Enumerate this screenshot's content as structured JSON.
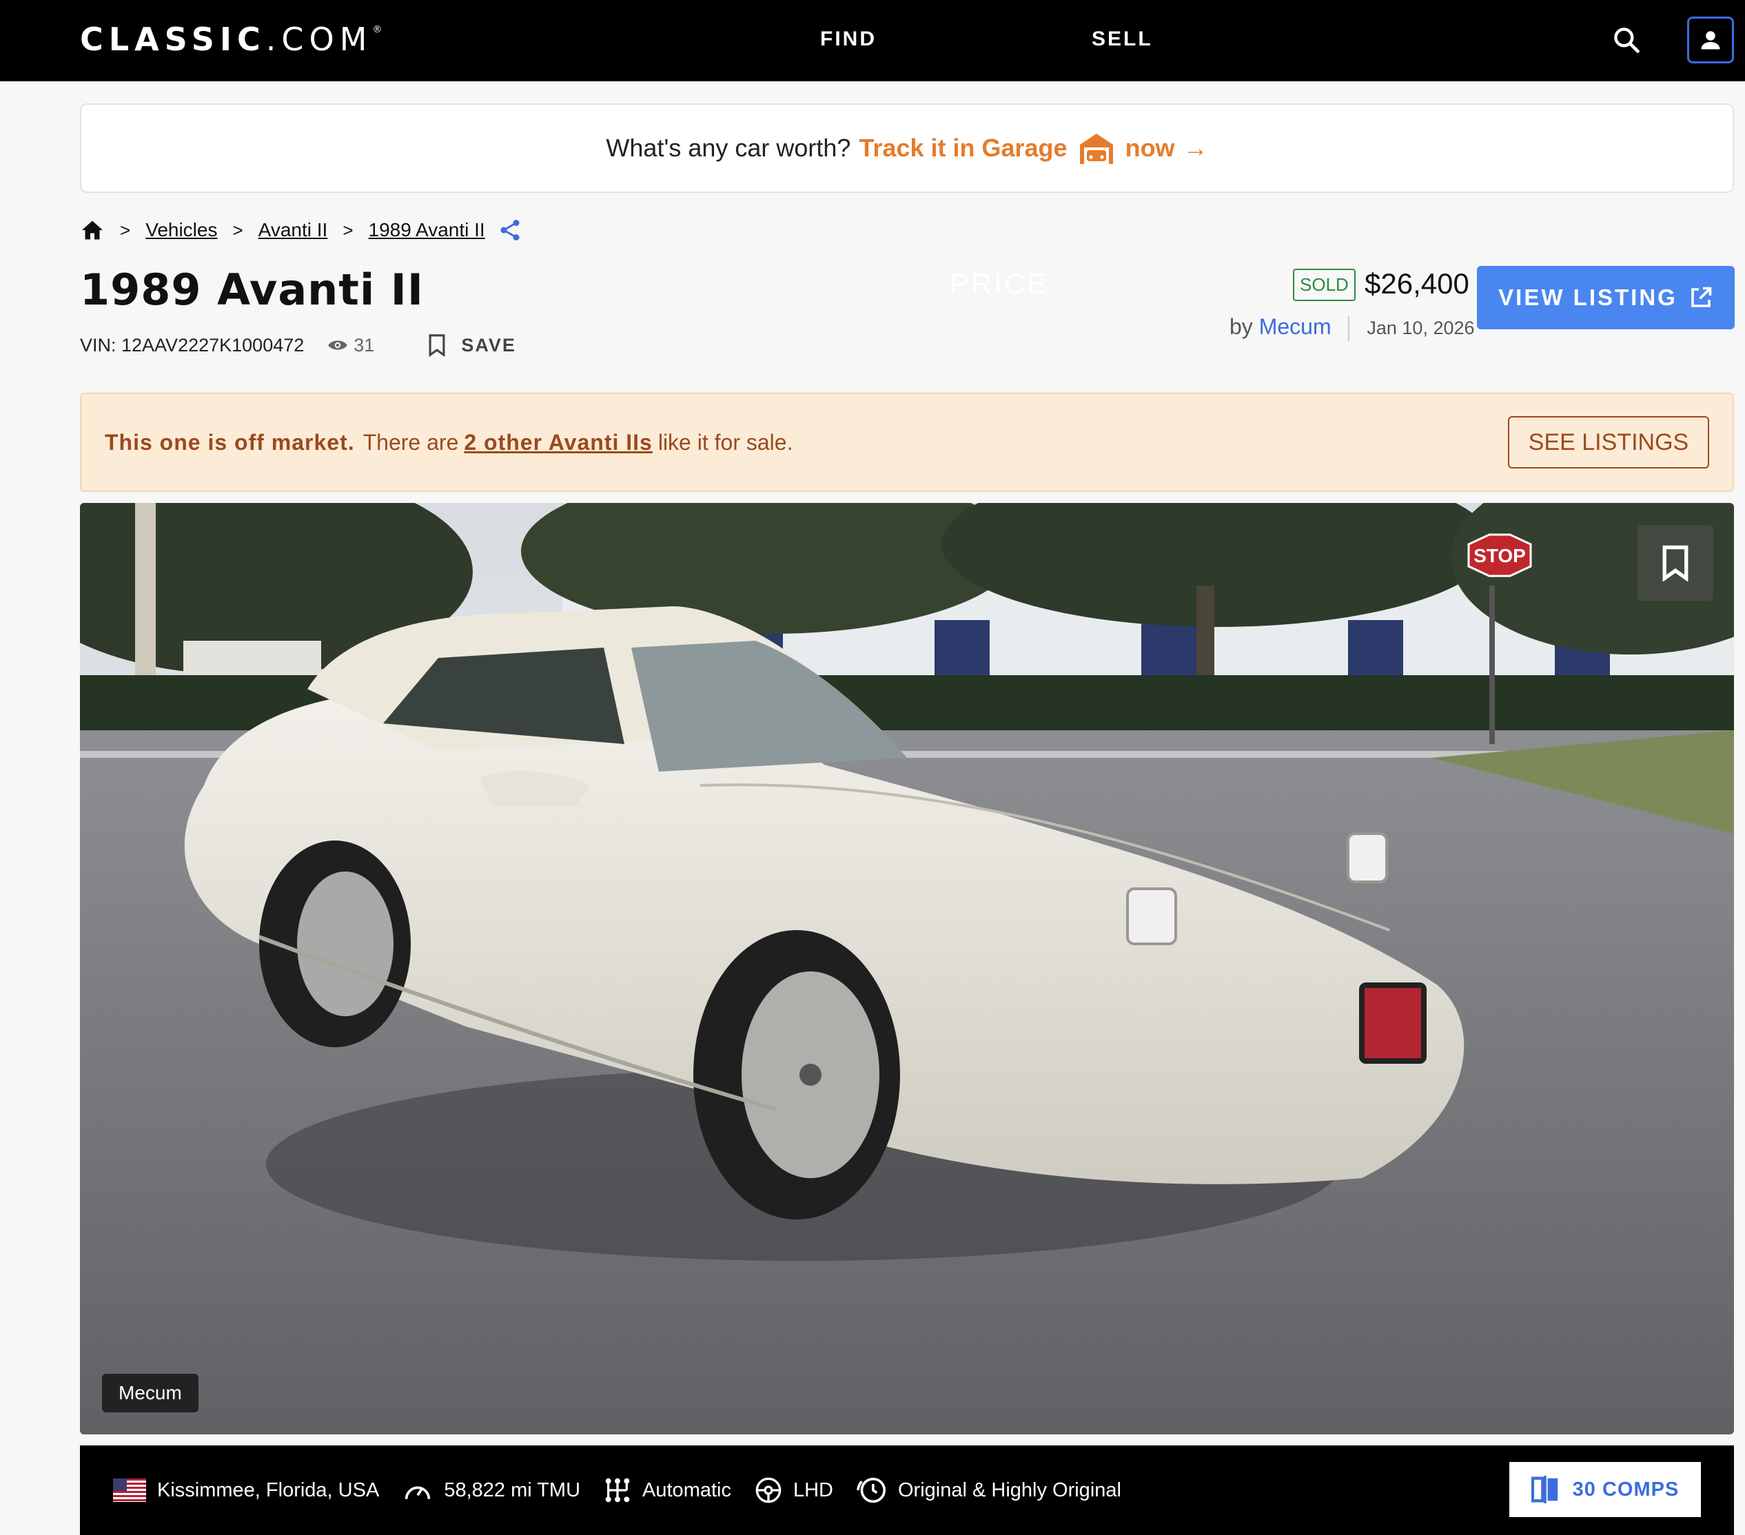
{
  "header": {
    "logo_main": "CLASSIC",
    "logo_suffix": ".COM",
    "logo_mark": "®",
    "nav": {
      "find": "FIND",
      "price": "PRICE",
      "sell": "SELL"
    }
  },
  "garage_banner": {
    "question": "What's any car worth?",
    "track": "Track it in Garage",
    "now": "now",
    "arrow": "→"
  },
  "breadcrumb": {
    "items": [
      "Vehicles",
      "Avanti II",
      "1989 Avanti II"
    ]
  },
  "listing": {
    "title": "1989 Avanti II",
    "vin": "VIN: 12AAV2227K1000472",
    "views": "31",
    "save_label": "SAVE",
    "status": "SOLD",
    "price": "$26,400",
    "by": "by",
    "seller": "Mecum",
    "date": "Jan 10, 2026",
    "view_listing": "VIEW LISTING"
  },
  "off_market": {
    "bold": "This one is off market.",
    "pre": "There are",
    "link": "2 other Avanti IIs",
    "post": "like it for sale.",
    "button": "SEE LISTINGS"
  },
  "photo": {
    "credit": "Mecum",
    "stop_sign": "STOP"
  },
  "info": {
    "location": "Kissimmee, Florida, USA",
    "mileage": "58,822 mi TMU",
    "transmission": "Automatic",
    "drive_side": "LHD",
    "originality": "Original & Highly Original",
    "comps": "30 COMPS"
  },
  "colors": {
    "accent_blue": "#4a86f0",
    "garage_orange": "#e57c2b",
    "sold_green": "#2e8b3e",
    "offmarket_bg": "#fcebd6",
    "offmarket_text": "#9a4a20"
  }
}
